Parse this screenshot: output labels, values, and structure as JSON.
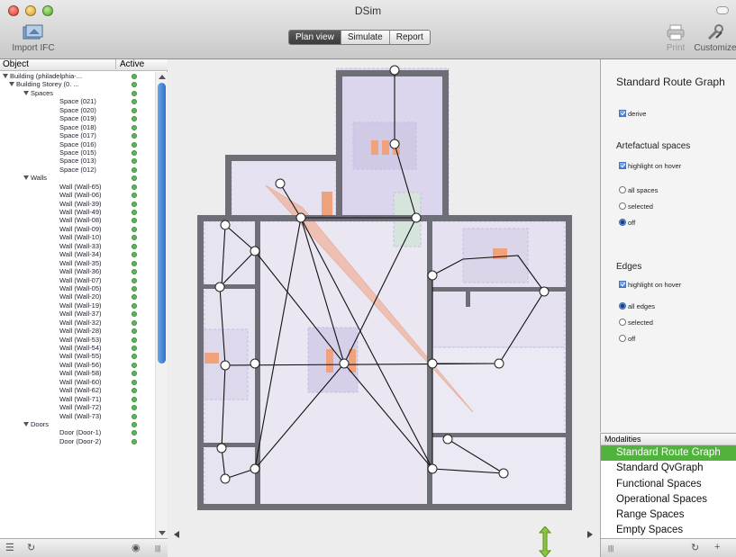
{
  "window": {
    "title": "DSim"
  },
  "toolbar": {
    "import_label": "Import IFC",
    "print_label": "Print",
    "customize_label": "Customize",
    "modes": [
      "Plan view",
      "Simulate",
      "Report"
    ],
    "active_mode": "Plan view"
  },
  "tree": {
    "columns": {
      "object": "Object",
      "active": "Active"
    },
    "rows": [
      {
        "label": "Building (philadelphia-...",
        "expander": true,
        "active": true
      },
      {
        "label": "Building Storey (0. ...",
        "expander": true,
        "active": true
      },
      {
        "label": "Spaces",
        "expander": true,
        "active": true
      },
      {
        "label": "Space (021)",
        "expander": false,
        "active": true
      },
      {
        "label": "Space (020)",
        "expander": false,
        "active": true
      },
      {
        "label": "Space (019)",
        "expander": false,
        "active": true
      },
      {
        "label": "Space (018)",
        "expander": false,
        "active": true
      },
      {
        "label": "Space (017)",
        "expander": false,
        "active": true
      },
      {
        "label": "Space (016)",
        "expander": false,
        "active": true
      },
      {
        "label": "Space (015)",
        "expander": false,
        "active": true
      },
      {
        "label": "Space (013)",
        "expander": false,
        "active": true
      },
      {
        "label": "Space (012)",
        "expander": false,
        "active": true
      },
      {
        "label": "Walls",
        "expander": true,
        "active": true
      },
      {
        "label": "Wall (Wall-65)",
        "expander": false,
        "active": true
      },
      {
        "label": "Wall (Wall-06)",
        "expander": false,
        "active": true
      },
      {
        "label": "Wall (Wall-39)",
        "expander": false,
        "active": true
      },
      {
        "label": "Wall (Wall-49)",
        "expander": false,
        "active": true
      },
      {
        "label": "Wall (Wall-08)",
        "expander": false,
        "active": true
      },
      {
        "label": "Wall (Wall-09)",
        "expander": false,
        "active": true
      },
      {
        "label": "Wall (Wall-10)",
        "expander": false,
        "active": true
      },
      {
        "label": "Wall (Wall-33)",
        "expander": false,
        "active": true
      },
      {
        "label": "Wall (Wall-34)",
        "expander": false,
        "active": true
      },
      {
        "label": "Wall (Wall-35)",
        "expander": false,
        "active": true
      },
      {
        "label": "Wall (Wall-36)",
        "expander": false,
        "active": true
      },
      {
        "label": "Wall (Wall-07)",
        "expander": false,
        "active": true
      },
      {
        "label": "Wall (Wall-05)",
        "expander": false,
        "active": true
      },
      {
        "label": "Wall (Wall-20)",
        "expander": false,
        "active": true
      },
      {
        "label": "Wall (Wall-19)",
        "expander": false,
        "active": true
      },
      {
        "label": "Wall (Wall-37)",
        "expander": false,
        "active": true
      },
      {
        "label": "Wall (Wall-32)",
        "expander": false,
        "active": true
      },
      {
        "label": "Wall (Wall-28)",
        "expander": false,
        "active": true
      },
      {
        "label": "Wall (Wall-53)",
        "expander": false,
        "active": true
      },
      {
        "label": "Wall (Wall-54)",
        "expander": false,
        "active": true
      },
      {
        "label": "Wall (Wall-55)",
        "expander": false,
        "active": true
      },
      {
        "label": "Wall (Wall-56)",
        "expander": false,
        "active": true
      },
      {
        "label": "Wall (Wall-58)",
        "expander": false,
        "active": true
      },
      {
        "label": "Wall (Wall-60)",
        "expander": false,
        "active": true
      },
      {
        "label": "Wall (Wall-62)",
        "expander": false,
        "active": true
      },
      {
        "label": "Wall (Wall-71)",
        "expander": false,
        "active": true
      },
      {
        "label": "Wall (Wall-72)",
        "expander": false,
        "active": true
      },
      {
        "label": "Wall (Wall-73)",
        "expander": false,
        "active": true
      },
      {
        "label": "Doors",
        "expander": true,
        "active": true
      },
      {
        "label": "Door (Door-1)",
        "expander": false,
        "active": true
      },
      {
        "label": "Door (Door-2)",
        "expander": false,
        "active": true
      }
    ],
    "footer_icons": [
      "list-icon",
      "refresh-icon",
      "eye-icon"
    ]
  },
  "inspector": {
    "title": "Standard Route Graph",
    "derive_label": "derive",
    "artefactual_heading": "Artefactual spaces",
    "artefactual_highlight_label": "highlight on hover",
    "artefactual_options": [
      "all spaces",
      "selected",
      "off"
    ],
    "artefactual_selected": "off",
    "edges_heading": "Edges",
    "edges_highlight_label": "highlight on hover",
    "edges_options": [
      "all edges",
      "selected",
      "off"
    ],
    "edges_selected": "all edges"
  },
  "modalities": {
    "heading": "Modalities",
    "items": [
      "Standard Route Graph",
      "Standard QvGraph",
      "Functional Spaces",
      "Operational Spaces",
      "Range Spaces",
      "Empty Spaces"
    ],
    "selected": "Standard Route Graph"
  },
  "colors": {
    "wall": "#6e6e76",
    "space_fill": "#ccc4e6",
    "door_fill": "#f0a27c",
    "highlight_triangle": "#f2a280",
    "selection_green": "#51b33d",
    "accent_blue": "#3f78d1"
  }
}
